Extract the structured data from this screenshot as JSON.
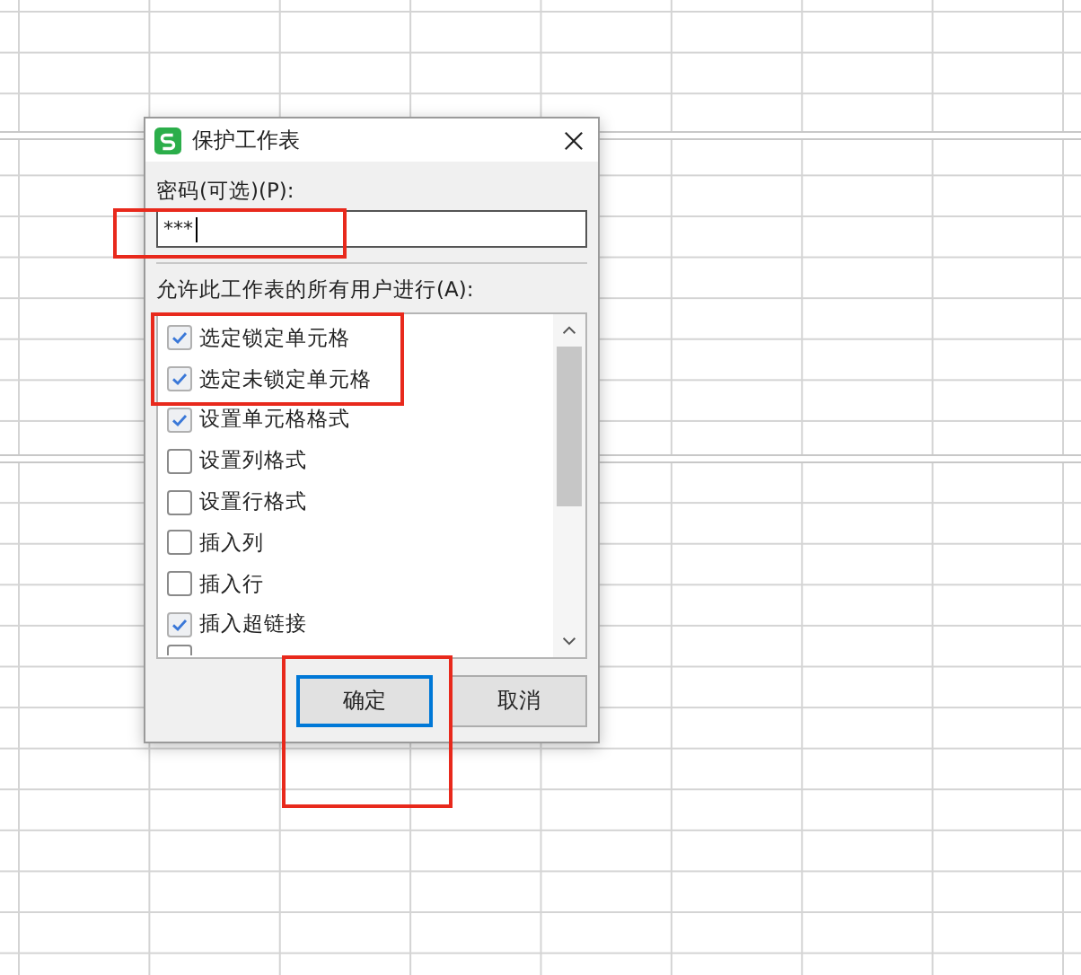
{
  "dialog": {
    "title": "保护工作表",
    "password_label": "密码(可选)(P):",
    "password_value": "***",
    "permissions_label": "允许此工作表的所有用户进行(A):",
    "permissions": [
      {
        "label": "选定锁定单元格",
        "checked": true
      },
      {
        "label": "选定未锁定单元格",
        "checked": true
      },
      {
        "label": "设置单元格格式",
        "checked": true
      },
      {
        "label": "设置列格式",
        "checked": false
      },
      {
        "label": "设置行格式",
        "checked": false
      },
      {
        "label": "插入列",
        "checked": false
      },
      {
        "label": "插入行",
        "checked": false
      },
      {
        "label": "插入超链接",
        "checked": true
      }
    ],
    "buttons": [
      {
        "label": "确定",
        "focused": true
      },
      {
        "label": "取消",
        "focused": false
      }
    ]
  }
}
